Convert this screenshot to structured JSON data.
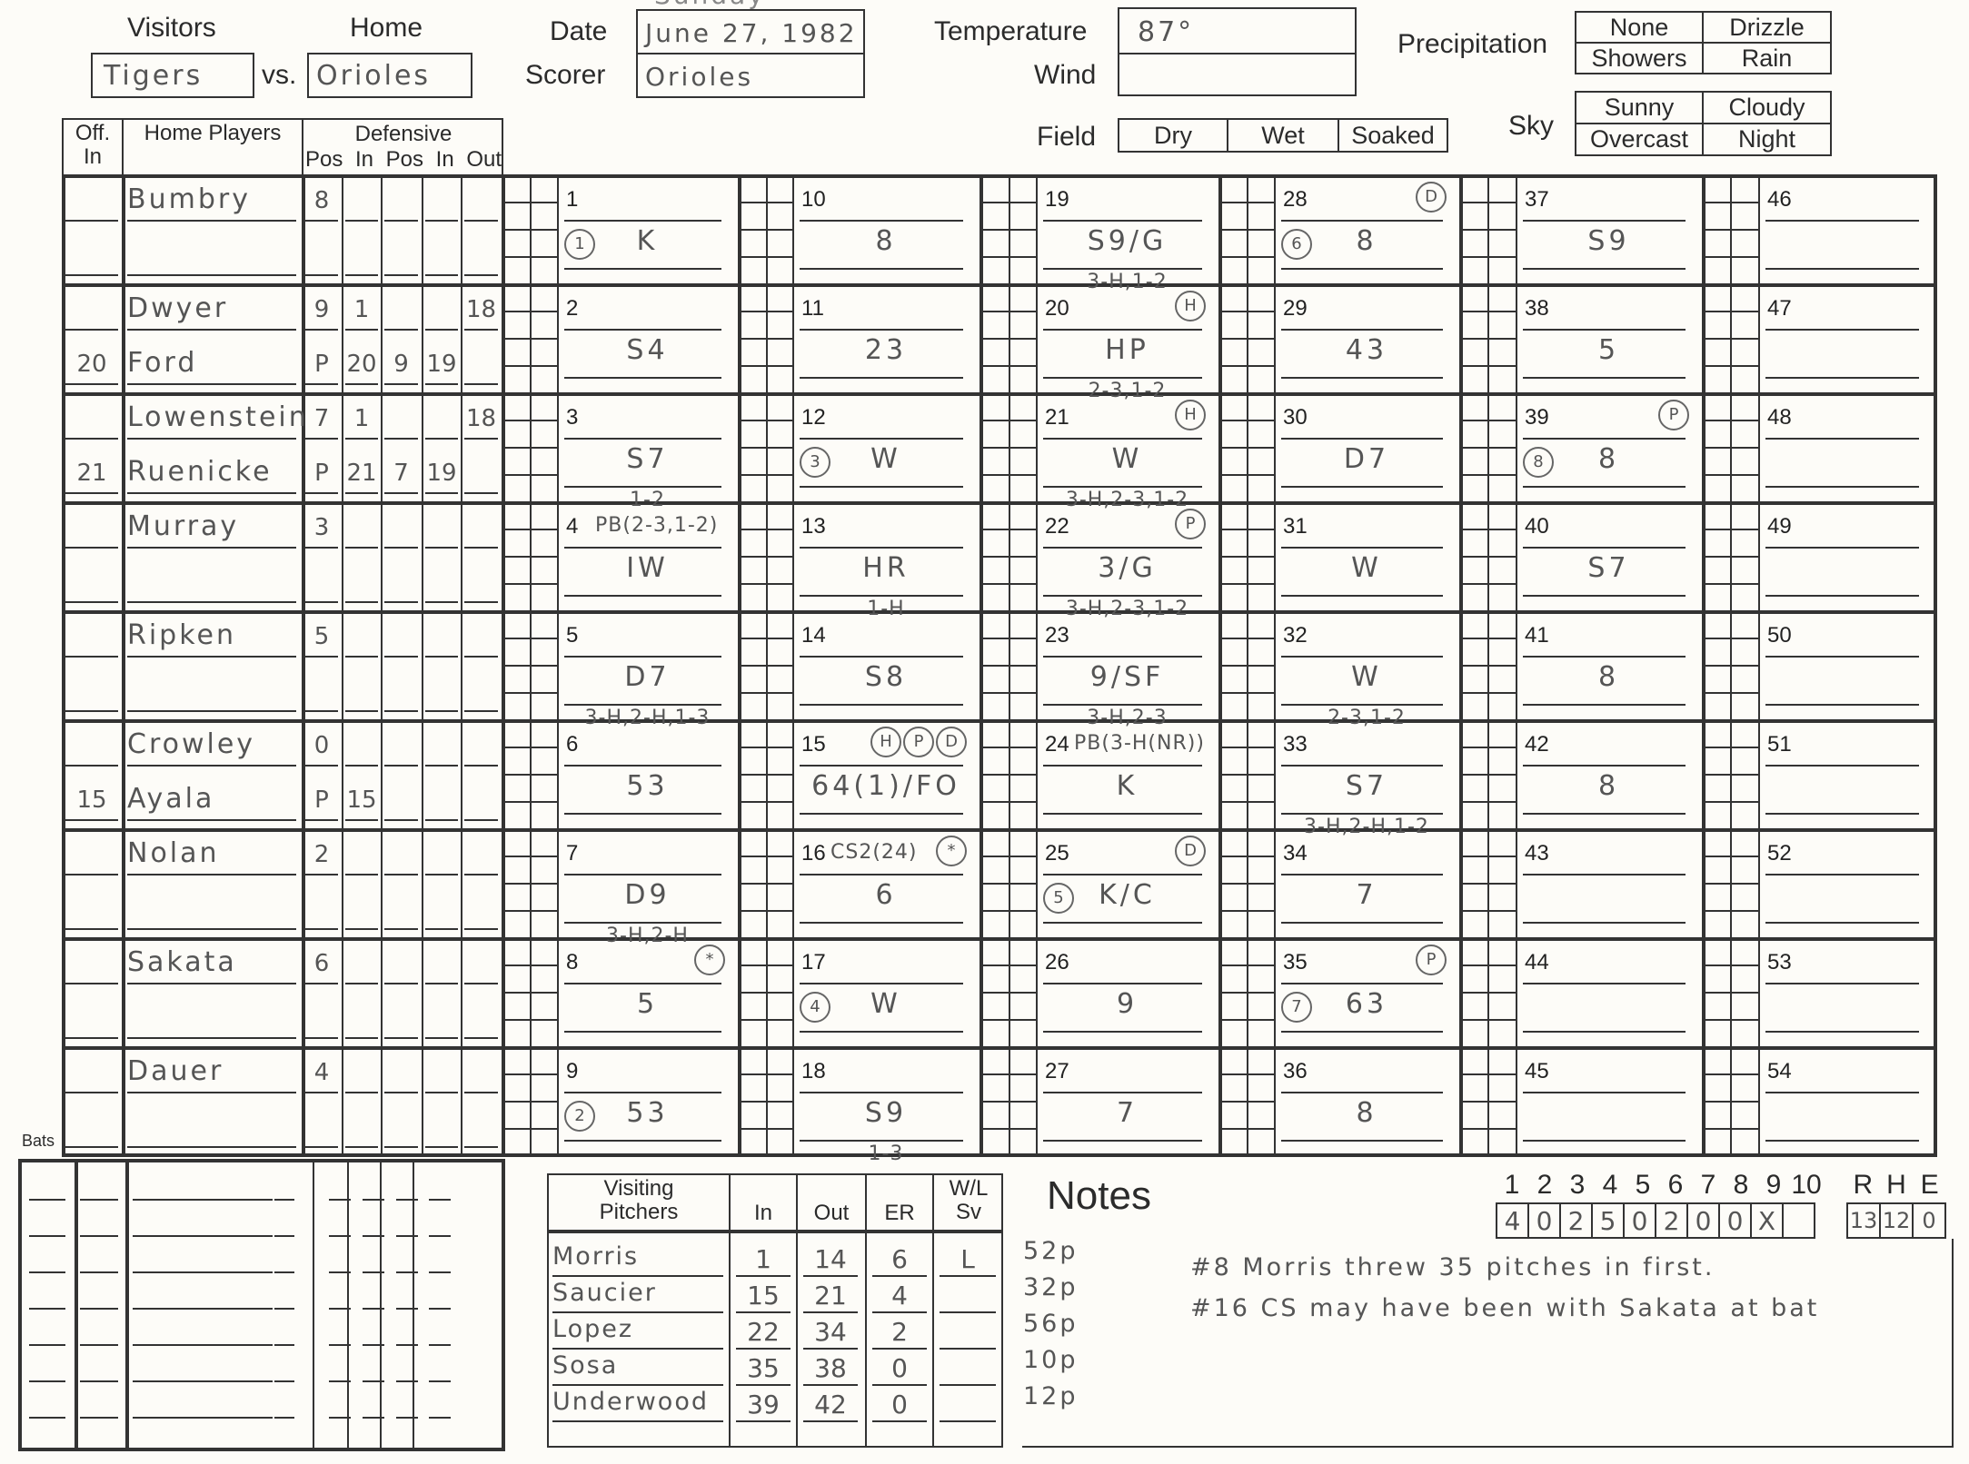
{
  "header": {
    "visitors_label": "Visitors",
    "home_label": "Home",
    "visitors_team": "Tigers",
    "vs_label": "vs.",
    "home_team": "Orioles",
    "above_date_fragment": "Sunday",
    "date_label": "Date",
    "date_value": "June 27, 1982",
    "scorer_label": "Scorer",
    "scorer_value": "Orioles",
    "temperature_label": "Temperature",
    "temperature_value": "87°",
    "wind_label": "Wind",
    "wind_value": "",
    "precipitation_label": "Precipitation",
    "precipitation_options": [
      "None",
      "Drizzle",
      "Showers",
      "Rain"
    ],
    "field_label": "Field",
    "field_options": [
      "Dry",
      "Wet",
      "Soaked"
    ],
    "sky_label": "Sky",
    "sky_options": [
      "Sunny",
      "Cloudy",
      "Overcast",
      "Night"
    ]
  },
  "lineup_headers": {
    "off_in": "Off. In",
    "home_players": "Home Players",
    "defensive": "Defensive",
    "pos1": "Pos",
    "in1": "In",
    "pos2": "Pos",
    "in2": "In",
    "out": "Out"
  },
  "lineup": [
    {
      "off_in": [
        "",
        ""
      ],
      "players": [
        "Bumbry",
        ""
      ],
      "pos1": [
        "8",
        ""
      ],
      "in1": [
        "",
        ""
      ],
      "pos2": [
        "",
        ""
      ],
      "in2": [
        "",
        ""
      ],
      "out": [
        "",
        ""
      ]
    },
    {
      "off_in": [
        "",
        "20"
      ],
      "players": [
        "Dwyer",
        "Ford"
      ],
      "pos1": [
        "9",
        "P"
      ],
      "in1": [
        "1",
        "20"
      ],
      "pos2": [
        "",
        "9"
      ],
      "in2": [
        "",
        "19"
      ],
      "out": [
        "18",
        ""
      ]
    },
    {
      "off_in": [
        "",
        "21"
      ],
      "players": [
        "Lowenstein",
        "Ruenicke"
      ],
      "pos1": [
        "7",
        "P"
      ],
      "in1": [
        "1",
        "21"
      ],
      "pos2": [
        "",
        "7"
      ],
      "in2": [
        "",
        "19"
      ],
      "out": [
        "18",
        ""
      ]
    },
    {
      "off_in": [
        "",
        ""
      ],
      "players": [
        "Murray",
        ""
      ],
      "pos1": [
        "3",
        ""
      ],
      "in1": [
        "",
        ""
      ],
      "pos2": [
        "",
        ""
      ],
      "in2": [
        "",
        ""
      ],
      "out": [
        "",
        ""
      ]
    },
    {
      "off_in": [
        "",
        ""
      ],
      "players": [
        "Ripken",
        ""
      ],
      "pos1": [
        "5",
        ""
      ],
      "in1": [
        "",
        ""
      ],
      "pos2": [
        "",
        ""
      ],
      "in2": [
        "",
        ""
      ],
      "out": [
        "",
        ""
      ]
    },
    {
      "off_in": [
        "",
        "15"
      ],
      "players": [
        "Crowley",
        "Ayala"
      ],
      "pos1": [
        "0",
        "P"
      ],
      "in1": [
        "",
        "15"
      ],
      "pos2": [
        "",
        ""
      ],
      "in2": [
        "",
        ""
      ],
      "out": [
        "",
        ""
      ]
    },
    {
      "off_in": [
        "",
        ""
      ],
      "players": [
        "Nolan",
        ""
      ],
      "pos1": [
        "2",
        ""
      ],
      "in1": [
        "",
        ""
      ],
      "pos2": [
        "",
        ""
      ],
      "in2": [
        "",
        ""
      ],
      "out": [
        "",
        ""
      ]
    },
    {
      "off_in": [
        "",
        ""
      ],
      "players": [
        "Sakata",
        ""
      ],
      "pos1": [
        "6",
        ""
      ],
      "in1": [
        "",
        ""
      ],
      "pos2": [
        "",
        ""
      ],
      "in2": [
        "",
        ""
      ],
      "out": [
        "",
        ""
      ]
    },
    {
      "off_in": [
        "",
        ""
      ],
      "players": [
        "Dauer",
        ""
      ],
      "pos1": [
        "4",
        ""
      ],
      "in1": [
        "",
        ""
      ],
      "pos2": [
        "",
        ""
      ],
      "in2": [
        "",
        ""
      ],
      "out": [
        "",
        ""
      ]
    }
  ],
  "bats_label": "Bats",
  "at_bats": [
    {
      "n": "1",
      "note": "",
      "out_no": "1",
      "result": "K",
      "adv": "",
      "marks": []
    },
    {
      "n": "2",
      "note": "",
      "out_no": "",
      "result": "S4",
      "adv": "",
      "marks": []
    },
    {
      "n": "3",
      "note": "",
      "out_no": "",
      "result": "S7",
      "adv": "1-2",
      "marks": []
    },
    {
      "n": "4",
      "note": "PB(2-3,1-2)",
      "out_no": "",
      "result": "IW",
      "adv": "",
      "marks": []
    },
    {
      "n": "5",
      "note": "",
      "out_no": "",
      "result": "D7",
      "adv": "3-H,2-H,1-3",
      "marks": []
    },
    {
      "n": "6",
      "note": "",
      "out_no": "",
      "result": "53",
      "adv": "",
      "marks": []
    },
    {
      "n": "7",
      "note": "",
      "out_no": "",
      "result": "D9",
      "adv": "3-H,2-H",
      "marks": []
    },
    {
      "n": "8",
      "note": "",
      "out_no": "",
      "result": "5",
      "adv": "",
      "marks": [
        "*"
      ]
    },
    {
      "n": "9",
      "note": "",
      "out_no": "2",
      "result": "53",
      "adv": "",
      "marks": []
    },
    {
      "n": "10",
      "note": "",
      "out_no": "",
      "result": "8",
      "adv": "",
      "marks": []
    },
    {
      "n": "11",
      "note": "",
      "out_no": "",
      "result": "23",
      "adv": "",
      "marks": []
    },
    {
      "n": "12",
      "note": "",
      "out_no": "3",
      "result": "W",
      "adv": "",
      "marks": []
    },
    {
      "n": "13",
      "note": "",
      "out_no": "",
      "result": "HR",
      "adv": "1-H",
      "marks": []
    },
    {
      "n": "14",
      "note": "",
      "out_no": "",
      "result": "S8",
      "adv": "",
      "marks": []
    },
    {
      "n": "15",
      "note": "",
      "out_no": "",
      "result": "64(1)/FO",
      "adv": "",
      "marks": [
        "H",
        "P",
        "D"
      ]
    },
    {
      "n": "16",
      "note": "CS2(24)",
      "out_no": "",
      "result": "6",
      "adv": "",
      "marks": [
        "*"
      ]
    },
    {
      "n": "17",
      "note": "",
      "out_no": "4",
      "result": "W",
      "adv": "",
      "marks": []
    },
    {
      "n": "18",
      "note": "",
      "out_no": "",
      "result": "S9",
      "adv": "1-3",
      "marks": []
    },
    {
      "n": "19",
      "note": "",
      "out_no": "",
      "result": "S9/G",
      "adv": "3-H,1-2",
      "marks": []
    },
    {
      "n": "20",
      "note": "",
      "out_no": "",
      "result": "HP",
      "adv": "2-3,1-2",
      "marks": [
        "H"
      ]
    },
    {
      "n": "21",
      "note": "",
      "out_no": "",
      "result": "W",
      "adv": "3-H,2-3,1-2",
      "marks": [
        "H"
      ]
    },
    {
      "n": "22",
      "note": "",
      "out_no": "",
      "result": "3/G",
      "adv": "3-H,2-3,1-2",
      "marks": [
        "P"
      ]
    },
    {
      "n": "23",
      "note": "",
      "out_no": "",
      "result": "9/SF",
      "adv": "3-H,2-3",
      "marks": []
    },
    {
      "n": "24",
      "note": "PB(3-H(NR))",
      "out_no": "",
      "result": "K",
      "adv": "",
      "marks": []
    },
    {
      "n": "25",
      "note": "",
      "out_no": "5",
      "result": "K/C",
      "adv": "",
      "marks": [
        "D"
      ]
    },
    {
      "n": "26",
      "note": "",
      "out_no": "",
      "result": "9",
      "adv": "",
      "marks": []
    },
    {
      "n": "27",
      "note": "",
      "out_no": "",
      "result": "7",
      "adv": "",
      "marks": []
    },
    {
      "n": "28",
      "note": "",
      "out_no": "6",
      "result": "8",
      "adv": "",
      "marks": [
        "D"
      ]
    },
    {
      "n": "29",
      "note": "",
      "out_no": "",
      "result": "43",
      "adv": "",
      "marks": []
    },
    {
      "n": "30",
      "note": "",
      "out_no": "",
      "result": "D7",
      "adv": "",
      "marks": []
    },
    {
      "n": "31",
      "note": "",
      "out_no": "",
      "result": "W",
      "adv": "",
      "marks": []
    },
    {
      "n": "32",
      "note": "",
      "out_no": "",
      "result": "W",
      "adv": "2-3,1-2",
      "marks": []
    },
    {
      "n": "33",
      "note": "",
      "out_no": "",
      "result": "S7",
      "adv": "3-H,2-H,1-2",
      "marks": []
    },
    {
      "n": "34",
      "note": "",
      "out_no": "",
      "result": "7",
      "adv": "",
      "marks": []
    },
    {
      "n": "35",
      "note": "",
      "out_no": "7",
      "result": "63",
      "adv": "",
      "marks": [
        "P"
      ]
    },
    {
      "n": "36",
      "note": "",
      "out_no": "",
      "result": "8",
      "adv": "",
      "marks": []
    },
    {
      "n": "37",
      "note": "",
      "out_no": "",
      "result": "S9",
      "adv": "",
      "marks": []
    },
    {
      "n": "38",
      "note": "",
      "out_no": "",
      "result": "5",
      "adv": "",
      "marks": []
    },
    {
      "n": "39",
      "note": "",
      "out_no": "8",
      "result": "8",
      "adv": "",
      "marks": [
        "P"
      ]
    },
    {
      "n": "40",
      "note": "",
      "out_no": "",
      "result": "S7",
      "adv": "",
      "marks": []
    },
    {
      "n": "41",
      "note": "",
      "out_no": "",
      "result": "8",
      "adv": "",
      "marks": []
    },
    {
      "n": "42",
      "note": "",
      "out_no": "",
      "result": "8",
      "adv": "",
      "marks": []
    },
    {
      "n": "43",
      "note": "",
      "out_no": "",
      "result": "",
      "adv": "",
      "marks": []
    },
    {
      "n": "44",
      "note": "",
      "out_no": "",
      "result": "",
      "adv": "",
      "marks": []
    },
    {
      "n": "45",
      "note": "",
      "out_no": "",
      "result": "",
      "adv": "",
      "marks": []
    },
    {
      "n": "46",
      "note": "",
      "out_no": "",
      "result": "",
      "adv": "",
      "marks": []
    },
    {
      "n": "47",
      "note": "",
      "out_no": "",
      "result": "",
      "adv": "",
      "marks": []
    },
    {
      "n": "48",
      "note": "",
      "out_no": "",
      "result": "",
      "adv": "",
      "marks": []
    },
    {
      "n": "49",
      "note": "",
      "out_no": "",
      "result": "",
      "adv": "",
      "marks": []
    },
    {
      "n": "50",
      "note": "",
      "out_no": "",
      "result": "",
      "adv": "",
      "marks": []
    },
    {
      "n": "51",
      "note": "",
      "out_no": "",
      "result": "",
      "adv": "",
      "marks": []
    },
    {
      "n": "52",
      "note": "",
      "out_no": "",
      "result": "",
      "adv": "",
      "marks": []
    },
    {
      "n": "53",
      "note": "",
      "out_no": "",
      "result": "",
      "adv": "",
      "marks": []
    },
    {
      "n": "54",
      "note": "",
      "out_no": "",
      "result": "",
      "adv": "",
      "marks": []
    }
  ],
  "pitchers": {
    "headers": {
      "name": "Visiting Pitchers",
      "in": "In",
      "out": "Out",
      "er": "ER",
      "wl": "W/L Sv"
    },
    "rows": [
      {
        "name": "Morris",
        "in": "1",
        "out": "14",
        "er": "6",
        "wl": "L",
        "pitches": "52p"
      },
      {
        "name": "Saucier",
        "in": "15",
        "out": "21",
        "er": "4",
        "wl": "",
        "pitches": "32p"
      },
      {
        "name": "Lopez",
        "in": "22",
        "out": "34",
        "er": "2",
        "wl": "",
        "pitches": "56p"
      },
      {
        "name": "Sosa",
        "in": "35",
        "out": "38",
        "er": "0",
        "wl": "",
        "pitches": "10p"
      },
      {
        "name": "Underwood",
        "in": "39",
        "out": "42",
        "er": "0",
        "wl": "",
        "pitches": "12p"
      }
    ]
  },
  "notes": {
    "title": "Notes",
    "lines": [
      "#8 Morris threw 35 pitches in first.",
      "#16 CS may have been with Sakata at bat"
    ]
  },
  "linescore": {
    "innings": [
      "1",
      "2",
      "3",
      "4",
      "5",
      "6",
      "7",
      "8",
      "9",
      "10"
    ],
    "runs": [
      "4",
      "0",
      "2",
      "5",
      "0",
      "2",
      "0",
      "0",
      "X",
      ""
    ],
    "rhe_labels": [
      "R",
      "H",
      "E"
    ],
    "rhe": [
      "13",
      "12",
      "0"
    ]
  }
}
